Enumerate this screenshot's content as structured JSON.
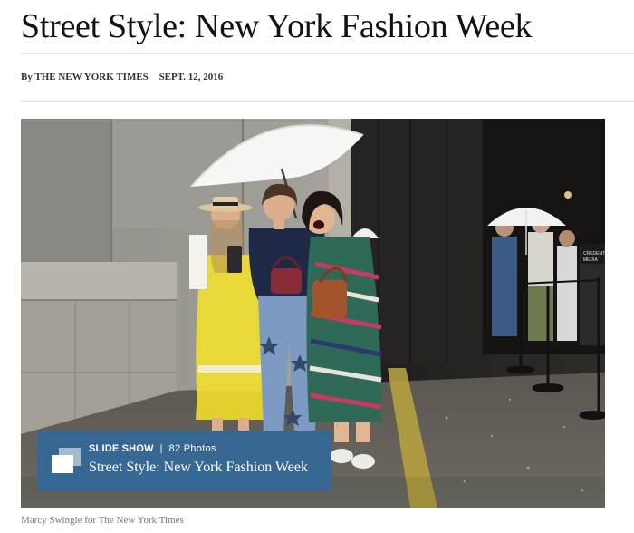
{
  "article": {
    "headline": "Street Style: New York Fashion Week",
    "byline": "By THE NEW YORK TIMES",
    "date": "SEPT. 12, 2016"
  },
  "slideshow": {
    "kicker_label": "SLIDE SHOW",
    "separator": "|",
    "photo_count": "82 Photos",
    "title": "Street Style: New York Fashion Week",
    "icon": "slideshow-icon",
    "accent_color": "#326898"
  },
  "photo": {
    "credit": "Marcy Swingle for The New York Times",
    "sign_text": "CREDENTIAL MEDIA"
  }
}
